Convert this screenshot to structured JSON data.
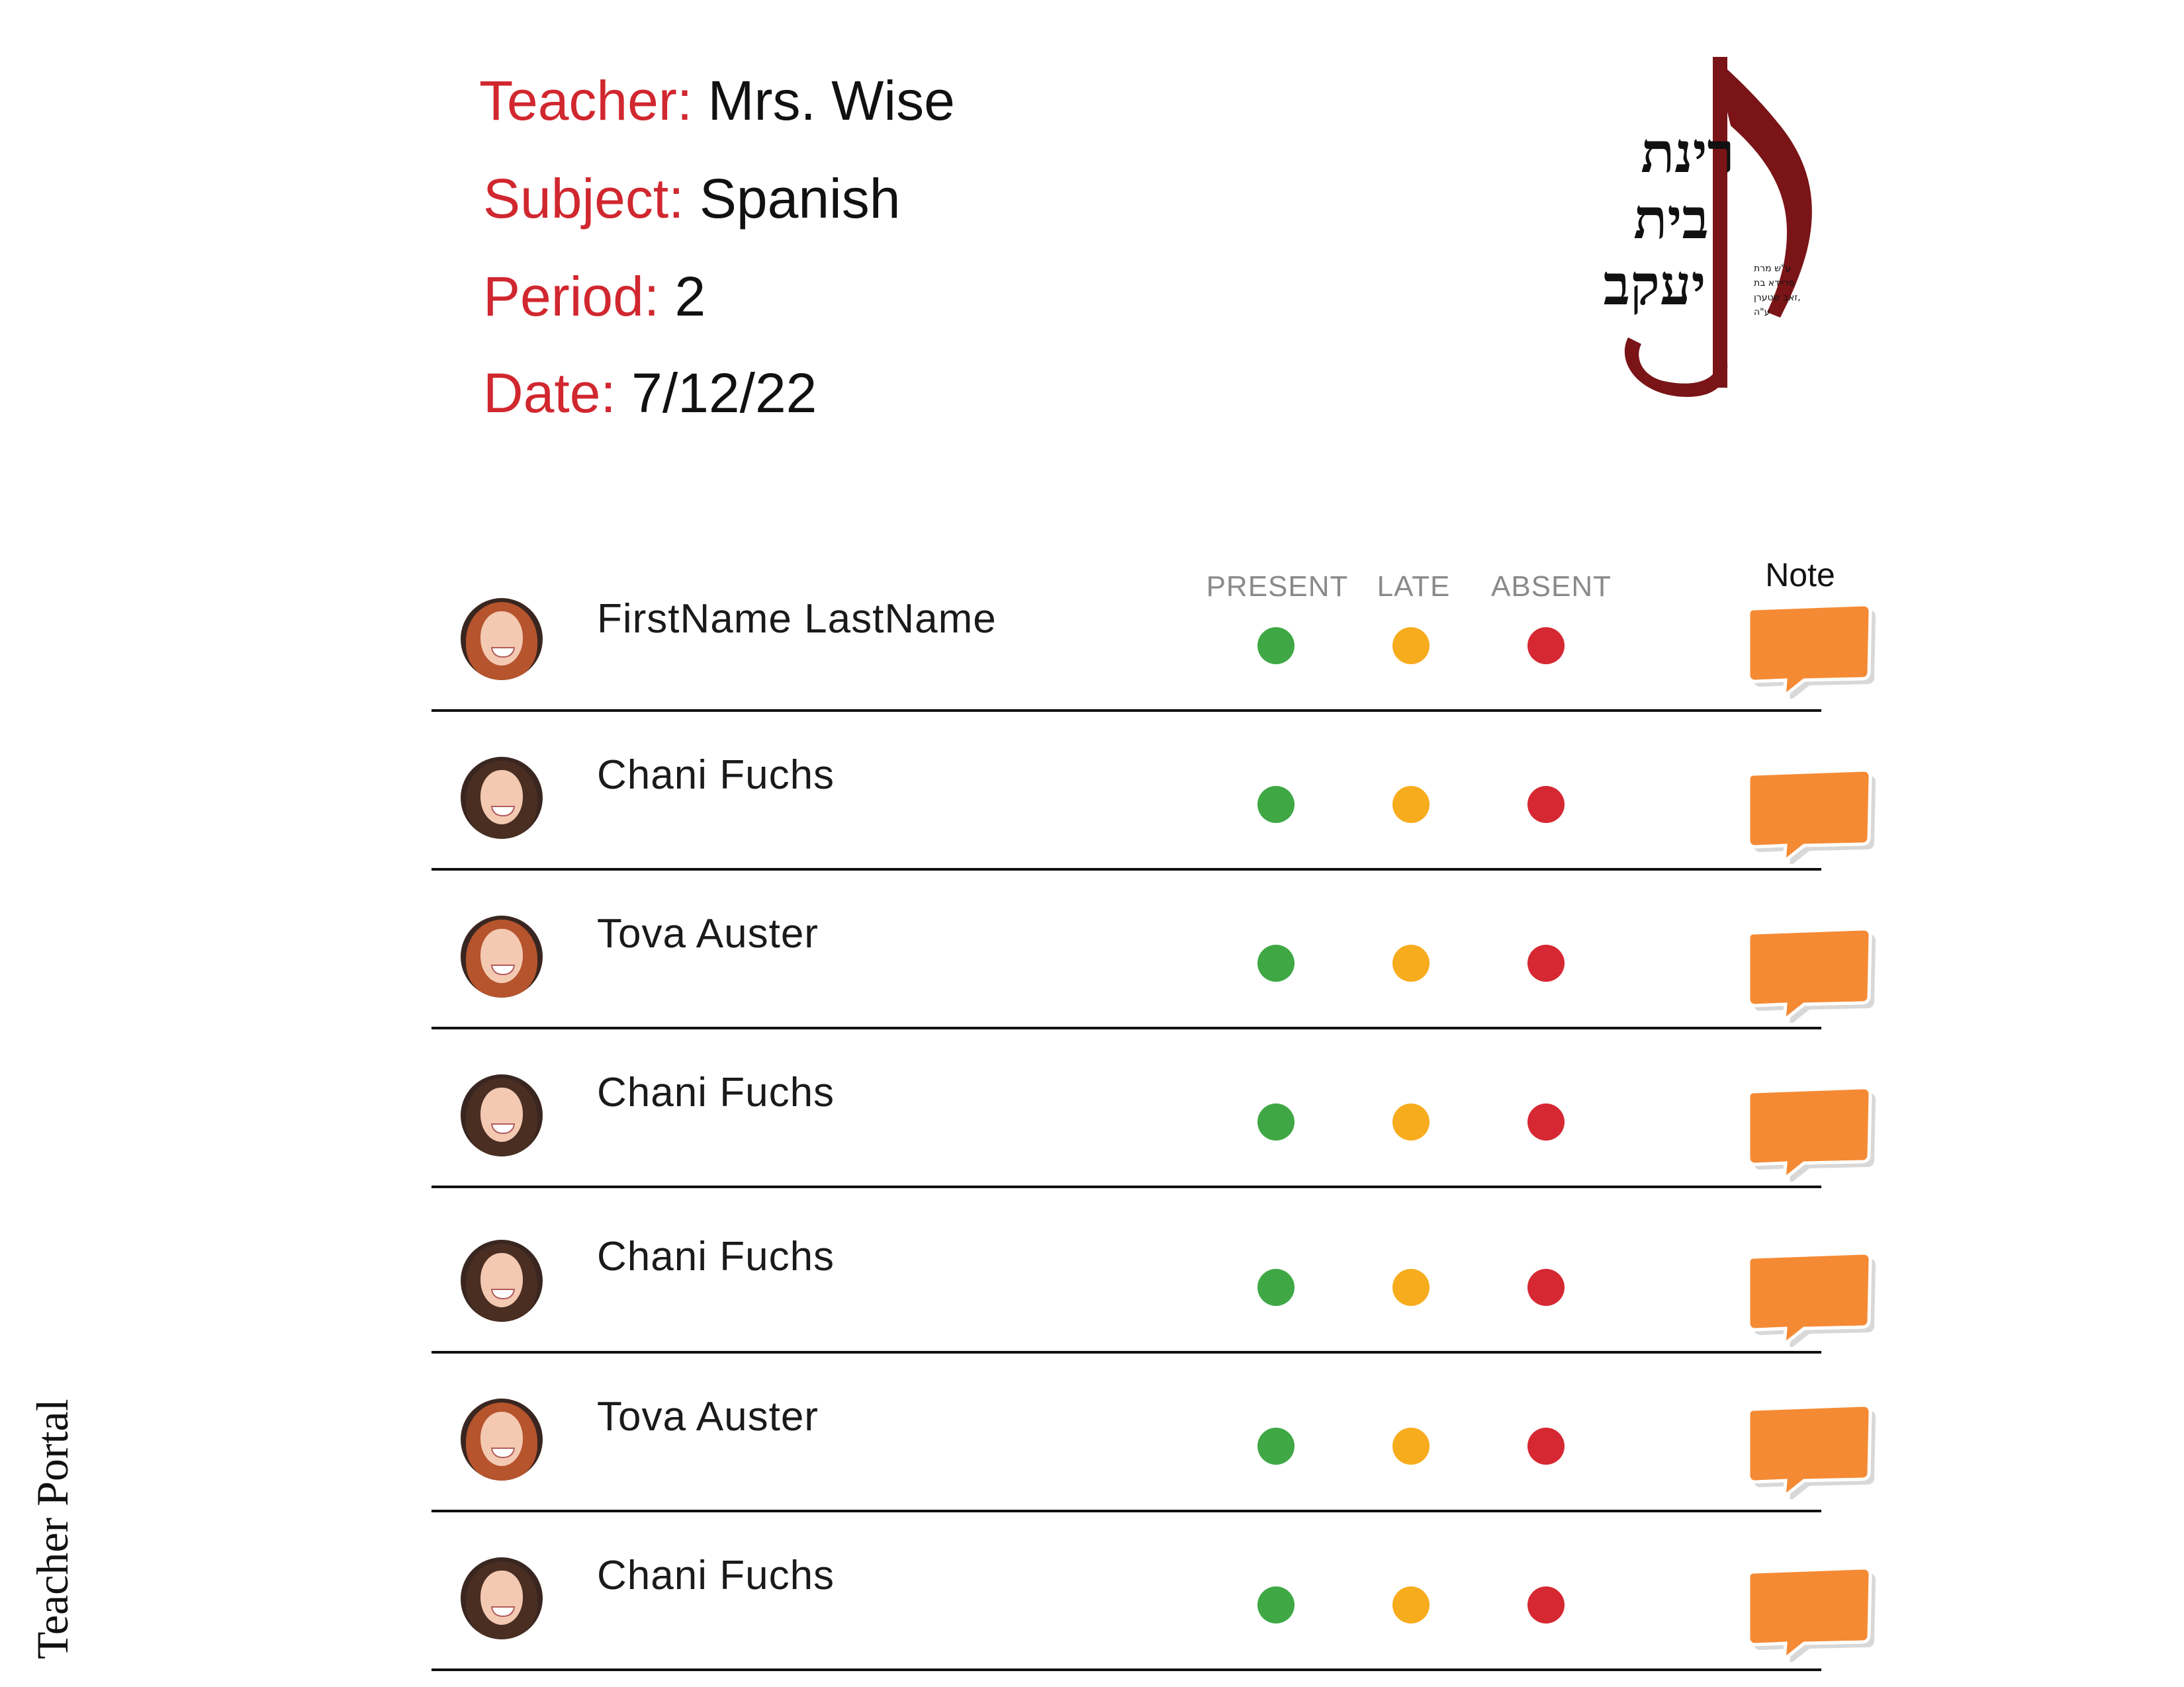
{
  "header": {
    "teacher_label": "Teacher:",
    "teacher_value": "Mrs. Wise",
    "subject_label": "Subject:",
    "subject_value": "Spanish",
    "period_label": "Period:",
    "period_value": "2",
    "date_label": "Date:",
    "date_value": "7/12/22"
  },
  "logo": {
    "line1": "רינת",
    "line2": "בית",
    "line3": "יעקב",
    "dedication": [
      "ע\"ש מרת",
      "פריידא בת",
      "זאב שטערן,",
      "ע\"ה"
    ],
    "color": "#7a1417"
  },
  "columns": {
    "present": "PRESENT",
    "late": "LATE",
    "absent": "ABSENT",
    "note": "Note"
  },
  "students": [
    {
      "name": "FirstName LastName",
      "hair": "red"
    },
    {
      "name": "Chani Fuchs",
      "hair": "brown"
    },
    {
      "name": "Tova Auster",
      "hair": "red"
    },
    {
      "name": "Chani Fuchs",
      "hair": "brown"
    },
    {
      "name": "Chani Fuchs",
      "hair": "brown"
    },
    {
      "name": "Tova Auster",
      "hair": "red"
    },
    {
      "name": "Chani Fuchs",
      "hair": "brown"
    }
  ],
  "status_colors": {
    "present": "#3fa845",
    "late": "#f7ac1d",
    "absent": "#d62832",
    "note": "#f58a34"
  },
  "side_label": "Teacher Portal"
}
